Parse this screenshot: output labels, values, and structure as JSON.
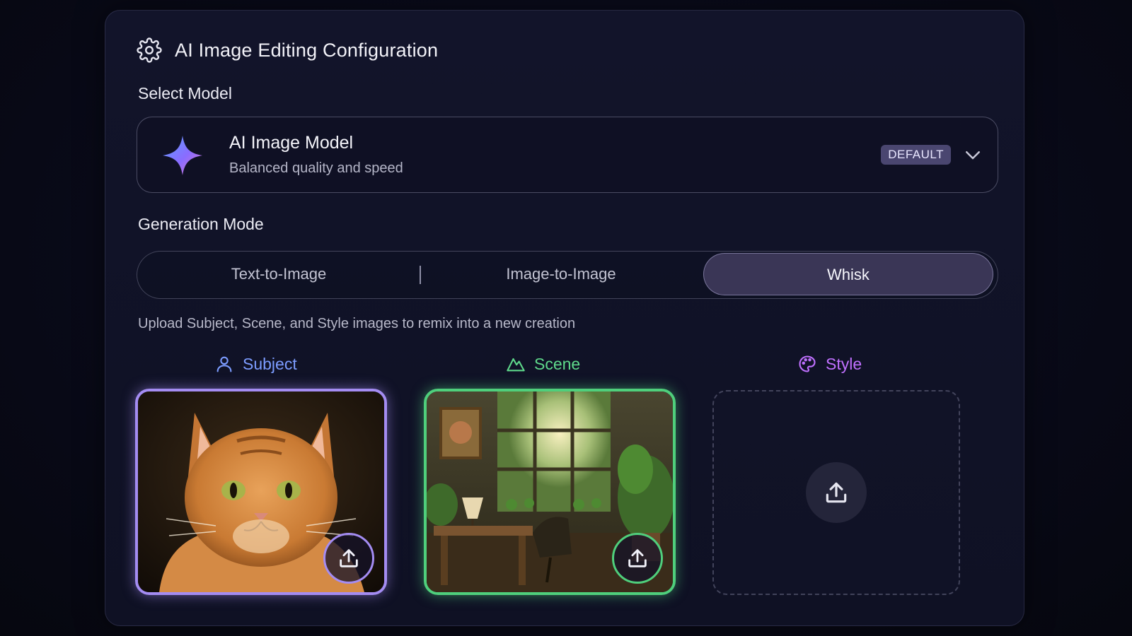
{
  "header": {
    "title": "AI Image Editing Configuration",
    "icon": "gear-icon"
  },
  "model_section": {
    "label": "Select Model",
    "selected_model": {
      "name": "AI Image Model",
      "description": "Balanced quality and speed",
      "badge": "DEFAULT",
      "icon": "sparkle-icon"
    }
  },
  "mode_section": {
    "label": "Generation Mode",
    "tabs": [
      {
        "label": "Text-to-Image",
        "active": false
      },
      {
        "label": "Image-to-Image",
        "active": false
      },
      {
        "label": "Whisk",
        "active": true
      }
    ],
    "hint": "Upload Subject, Scene, and Style images to remix into a new creation"
  },
  "slots": [
    {
      "label": "Subject",
      "color": "#7c9cff",
      "icon": "person-icon",
      "filled": true,
      "image": "orange tabby cat portrait"
    },
    {
      "label": "Scene",
      "color": "#5ed88a",
      "icon": "mountain-icon",
      "filled": true,
      "image": "sunlit study room with window and plants"
    },
    {
      "label": "Style",
      "color": "#c070ff",
      "icon": "palette-icon",
      "filled": false
    }
  ],
  "colors": {
    "subject_accent": "#a48cf2",
    "scene_accent": "#4fcf7c",
    "style_accent": "#c070ff",
    "badge_bg": "#4a4670"
  }
}
